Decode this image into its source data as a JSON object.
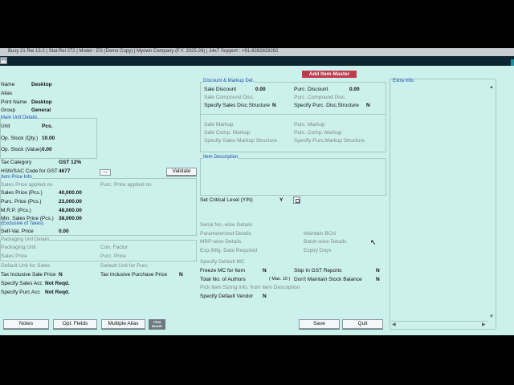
{
  "titlebar": "Busy 21  Rel 13.2  |  Stat.Rel 272  |  Model : ES (Demo Copy)  |  Myown Company (F.Y. 2025-26)  |   24x7 Support : +91-8282828282",
  "strip_button": ">>",
  "header_button": "Add Item Master",
  "left": {
    "name_label": "Name",
    "name_value": "Desktop",
    "alias_label": "Alias",
    "print_name_label": "Print Name",
    "print_name_value": "Desktop",
    "group_label": "Group",
    "group_value": "General",
    "main_unit_title": "Main Unit Details",
    "unit_label": "Unit",
    "unit_value": "Pcs.",
    "op_qty_label": "Op. Stock (Qty.)",
    "op_qty_value": "10.00",
    "op_value_label": "Op. Stock (Value)",
    "op_value_value": "0.00",
    "tax_cat_label": "Tax Category",
    "tax_cat_value": "GST 12%",
    "hsn_label": "HSN/SAC Code for GST",
    "hsn_value": "4677",
    "hsn_btn": "...",
    "validate_btn": "Validate",
    "item_price_title": "Item Price Info",
    "sales_price_applied": "Sales Price applied on",
    "purc_price_applied": "Purc. Price applied on",
    "sales_price_label": "Sales Price (Pcs.)",
    "sales_price_value": "40,000.00",
    "purc_price_label": "Purc. Price (Pcs.)",
    "purc_price_value": "23,000.00",
    "mrp_label": "M.R.P. (Pcs.)",
    "mrp_value": "48,000.00",
    "min_sales_label": "Min. Sales Price (Pcs.)",
    "min_sales_value": "38,000.00",
    "exclusive_taxes": "(Exclusive of Taxes)",
    "self_val_label": "Self-Val. Price",
    "self_val_value": "0.00",
    "packaging_title": "Packaging Unit Details",
    "packaging_unit": "Packaging Unit",
    "con_factor": "Con. Factor",
    "sales_price": "Sales Price",
    "purc_price": "Purc. Price",
    "default_unit_sales": "Default Unit for Sales",
    "default_unit_purc": "Default Unit for Purc.",
    "tax_incl_sale_label": "Tax Inclusive Sale Price",
    "tax_incl_sale_value": "N",
    "tax_incl_purc_label": "Tax Inclusive Purchase Price",
    "tax_incl_purc_value": "N",
    "spec_sales_acc_label": "Specify Sales Acc",
    "spec_sales_acc_value": "Not Reqd.",
    "spec_purc_acc_label": "Specify Purc Acc",
    "spec_purc_acc_value": "Not Reqd."
  },
  "middle": {
    "discount_title": "Discount & Markup Det.",
    "sale_discount_label": "Sale Discount",
    "sale_discount_value": "0.00",
    "purc_discount_label": "Purc. Discount",
    "purc_discount_value": "0.00",
    "sale_compound_disc": "Sale Compound Disc.",
    "purc_compound_disc": "Purc. Compound Disc.",
    "spec_sales_disc_label": "Specify Sales Disc.Structure",
    "spec_sales_disc_value": "N",
    "spec_purc_disc_label": "Specify Purc. Disc.Structure",
    "spec_purc_disc_value": "N",
    "sale_markup": "Sale Markup",
    "purc_markup": "Purc. Markup",
    "sale_comp_markup": "Sale Comp. Markup",
    "purc_comp_markup": "Purc. Comp. Markup",
    "spec_sales_markup": "Specify Sales Markup Structure",
    "spec_purc_markup": "Specify Purc.Markup Structure",
    "item_desc_title": "Item Description",
    "set_critical_label": "Set Critical Level (Y/N)",
    "set_critical_value": "Y",
    "serial_no": "Serial No.-wise Details",
    "maintain_bcn": "Maintain BCN",
    "parameterized": "Parameterized Details",
    "batch_wise": "Batch-wise Details",
    "mrp_wise": "MRP-wise Details",
    "expiry_days": "Expiry Days",
    "exp_mfg": "Exp./Mfg. Date Required",
    "spec_default_mc": "Specify Default MC",
    "freeze_mc_label": "Freeze MC for Item",
    "freeze_mc_value": "N",
    "skip_gst_label": "Skip In GST Reports",
    "skip_gst_value": "N",
    "total_authors_label": "Total No. of Authors",
    "total_authors_max": "( Max. 10 )",
    "dont_maintain_label": "Don't Maintain Stock Balance",
    "dont_maintain_value": "N",
    "pick_sizing": "Pick Item Sizing Info. from Item Description",
    "spec_vendor_label": "Specify Default Vendor",
    "spec_vendor_value": "N"
  },
  "extra": {
    "title": "Extra Info."
  },
  "bottom": {
    "notes": "Notes",
    "opt_fields": "Opt. Fields",
    "multiple_alias": "Multiple Alias",
    "item_image_1": "ITEM",
    "item_image_2": "IMAGE",
    "save": "Save",
    "quit": "Quit"
  }
}
